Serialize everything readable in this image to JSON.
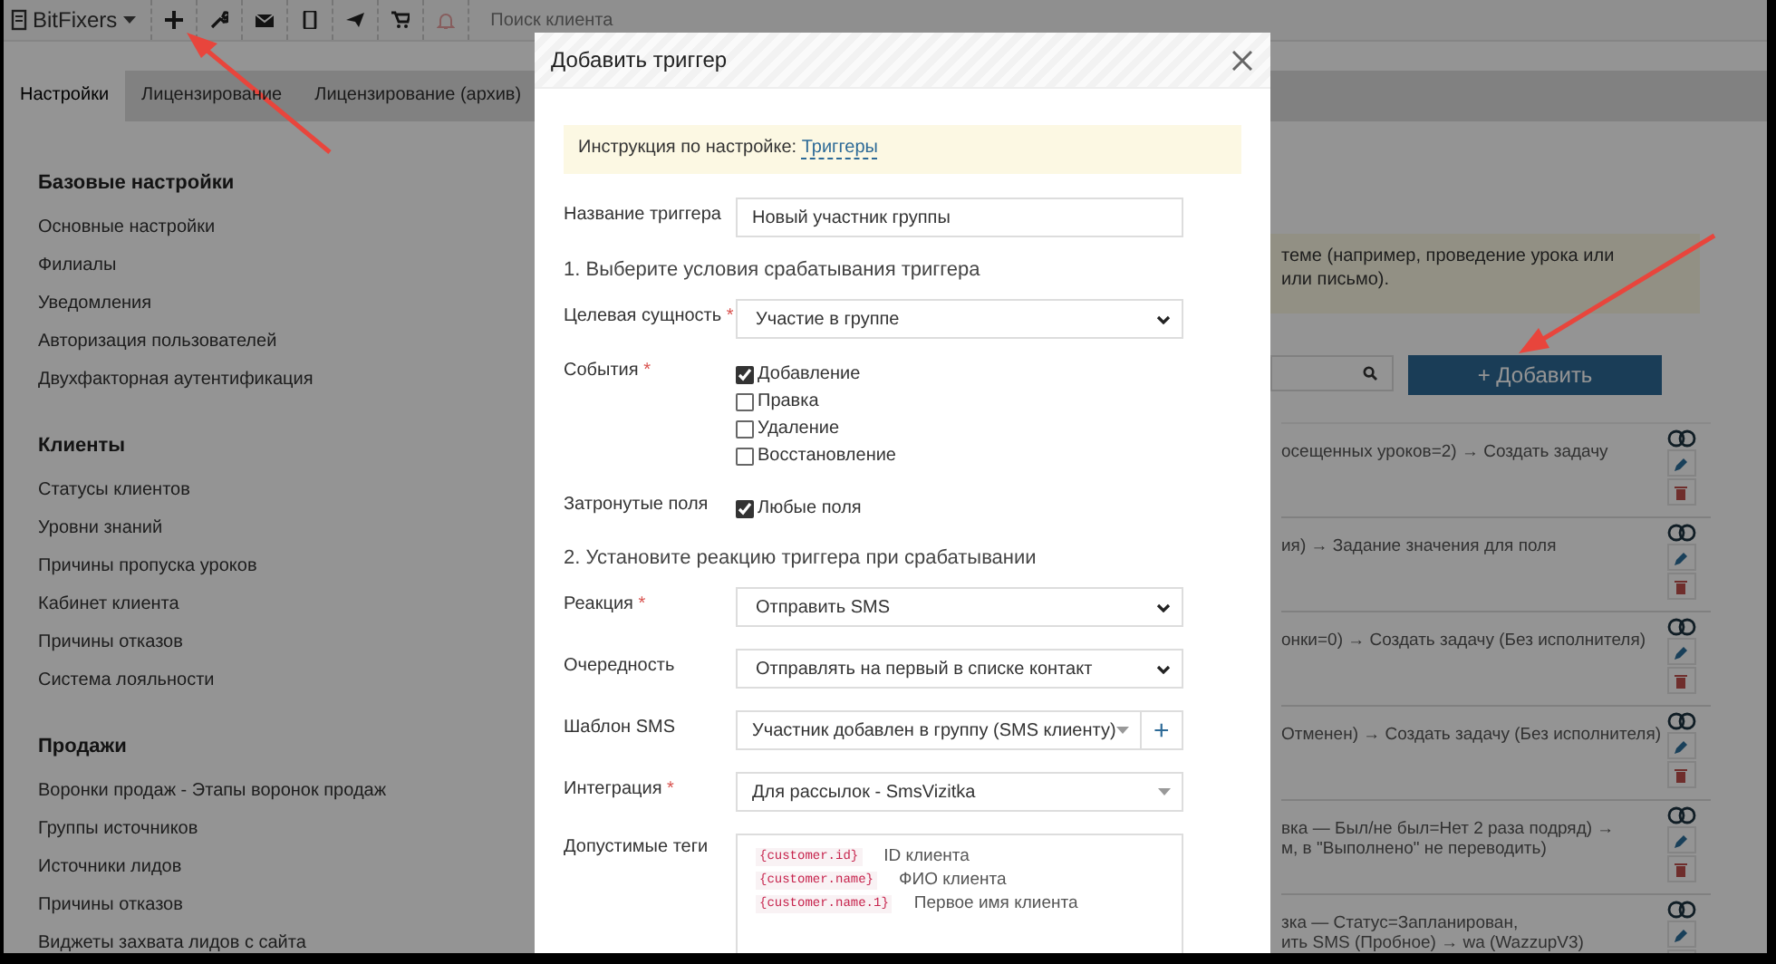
{
  "topbar": {
    "brand": "BitFixers",
    "search_placeholder": "Поиск клиента"
  },
  "tabs": [
    {
      "label": "Настройки",
      "selected": true
    },
    {
      "label": "Лицензирование",
      "selected": false
    },
    {
      "label": "Лицензирование (архив)",
      "selected": false
    }
  ],
  "sidebar": {
    "sections": [
      {
        "title": "Базовые настройки",
        "items": [
          "Основные настройки",
          "Филиалы",
          "Уведомления",
          "Авторизация пользователей",
          "Двухфакторная аутентификация"
        ]
      },
      {
        "title": "Клиенты",
        "items": [
          "Статусы клиентов",
          "Уровни знаний",
          "Причины пропуска уроков",
          "Кабинет клиента",
          "Причины отказов",
          "Система лояльности"
        ]
      },
      {
        "title": "Продажи",
        "items": [
          "Воронки продаж - Этапы воронок продаж",
          "Группы источников",
          "Источники лидов",
          "Причины отказов",
          "Виджеты захвата лидов с сайта"
        ]
      }
    ]
  },
  "notice": {
    "lines": [
      "теме (например, проведение урока или",
      "или письмо)."
    ]
  },
  "add_button": "+ Добавить",
  "triggers": [
    {
      "lines": [
        "осещенных уроков=2) → Создать задачу"
      ]
    },
    {
      "lines": [
        "ия) → Задание значения для поля"
      ]
    },
    {
      "lines": [
        "онки=0) → Создать задачу (Без исполнителя)"
      ]
    },
    {
      "lines": [
        "Отменен) → Создать задачу (Без исполнителя)"
      ]
    },
    {
      "lines": [
        "вка — Был/не был=Нет 2 раза подряд) →",
        "м, в \"Выполнено\" не переводить)"
      ]
    },
    {
      "lines": [
        "зка — Статус=Запланирован,",
        "ить SMS (Пробное) → wa (WazzupV3)"
      ]
    }
  ],
  "modal": {
    "title": "Добавить триггер",
    "help": {
      "text": "Инструкция по настройке:",
      "link": "Триггеры"
    },
    "fields": [
      {
        "kind": "input",
        "label": "Название триггера",
        "value": "Новый участник группы"
      },
      {
        "kind": "heading",
        "text": "1. Выберите условия срабатывания триггера"
      },
      {
        "kind": "select",
        "label": "Целевая сущность",
        "required_mark": "*",
        "value": "Участие в группе"
      },
      {
        "kind": "checkboxes",
        "label": "События",
        "required_mark": "*",
        "options": [
          {
            "label": "Добавление",
            "checked": true
          },
          {
            "label": "Правка",
            "checked": false
          },
          {
            "label": "Удаление",
            "checked": false
          },
          {
            "label": "Восстановление",
            "checked": false
          }
        ]
      },
      {
        "kind": "checkboxes",
        "label": "Затронутые поля",
        "options": [
          {
            "label": "Любые поля",
            "checked": true
          }
        ]
      },
      {
        "kind": "heading",
        "text": "2. Установите реакцию триггера при срабатывании"
      },
      {
        "kind": "select",
        "label": "Реакция",
        "required_mark": "*",
        "value": "Отправить SMS"
      },
      {
        "kind": "select",
        "label": "Очередность",
        "value": "Отправлять на первый в списке контакт"
      },
      {
        "kind": "combo",
        "label": "Шаблон SMS",
        "value": "Участник добавлен в группу (SMS клиенту)",
        "add": "+"
      },
      {
        "kind": "combo",
        "label": "Интеграция",
        "required_mark": "*",
        "value": "Для рассылок - SmsVizitka"
      },
      {
        "kind": "tags",
        "label": "Допустимые теги",
        "tags": [
          {
            "code": "{customer.id}",
            "text": "ID клиента"
          },
          {
            "code": "{customer.name}",
            "text": "ФИО клиента"
          },
          {
            "code": "{customer.name.1}",
            "text": "Первое имя клиента"
          }
        ]
      }
    ]
  }
}
